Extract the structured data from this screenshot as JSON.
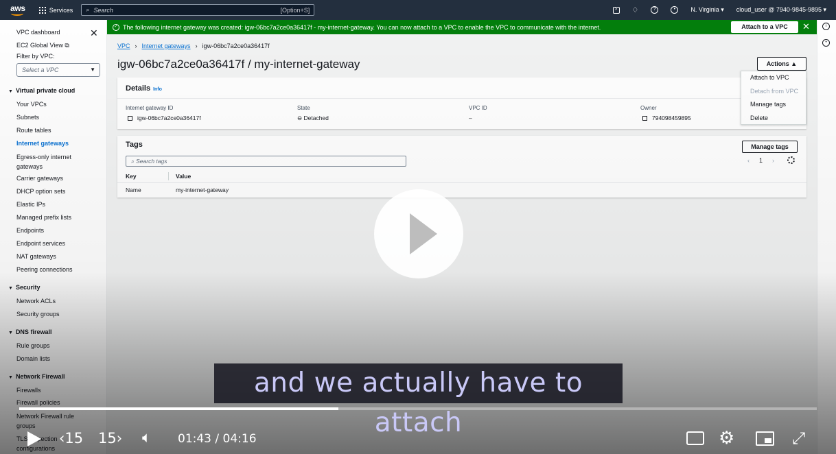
{
  "topnav": {
    "logo": "aws",
    "services": "Services",
    "search_placeholder": "Search",
    "search_shortcut": "[Option+S]",
    "region": "N. Virginia ▾",
    "account": "cloud_user @ 7940-9845-9895 ▾"
  },
  "sidebar": {
    "items": [
      "VPC dashboard",
      "EC2 Global View",
      "Filter by VPC:"
    ],
    "vpc_select": "Select a VPC",
    "groups": [
      {
        "title": "Virtual private cloud",
        "items": [
          "Your VPCs",
          "Subnets",
          "Route tables",
          "Internet gateways",
          "Egress-only internet gateways",
          "Carrier gateways",
          "DHCP option sets",
          "Elastic IPs",
          "Managed prefix lists",
          "Endpoints",
          "Endpoint services",
          "NAT gateways",
          "Peering connections"
        ]
      },
      {
        "title": "Security",
        "items": [
          "Network ACLs",
          "Security groups"
        ]
      },
      {
        "title": "DNS firewall",
        "items": [
          "Rule groups",
          "Domain lists"
        ]
      },
      {
        "title": "Network Firewall",
        "items": [
          "Firewalls",
          "Firewall policies",
          "Network Firewall rule groups",
          "TLS inspection configurations"
        ]
      }
    ],
    "active": "Internet gateways"
  },
  "banner": {
    "message": "The following internet gateway was created: igw-06bc7a2ce0a36417f - my-internet-gateway. You can now attach to a VPC to enable the VPC to communicate with the internet.",
    "button": "Attach to a VPC"
  },
  "breadcrumb": [
    "VPC",
    "Internet gateways",
    "igw-06bc7a2ce0a36417f"
  ],
  "page_title": "igw-06bc7a2ce0a36417f / my-internet-gateway",
  "actions": {
    "label": "Actions ▲",
    "menu": [
      "Attach to VPC",
      "Detach from VPC",
      "Manage tags",
      "Delete"
    ]
  },
  "details": {
    "title": "Details",
    "info": "Info",
    "fields": [
      {
        "label": "Internet gateway ID",
        "value": "igw-06bc7a2ce0a36417f"
      },
      {
        "label": "State",
        "value": "Detached"
      },
      {
        "label": "VPC ID",
        "value": "–"
      },
      {
        "label": "Owner",
        "value": "794098459895"
      }
    ]
  },
  "tags": {
    "title": "Tags",
    "manage": "Manage tags",
    "search_placeholder": "Search tags",
    "page": "1",
    "headers": [
      "Key",
      "Value"
    ],
    "rows": [
      [
        "Name",
        "my-internet-gateway"
      ]
    ]
  },
  "video": {
    "caption": "and we actually have to attach",
    "time": "01:43 / 04:16",
    "progress": 0.4,
    "skip_back": "15",
    "skip_fwd": "15"
  }
}
